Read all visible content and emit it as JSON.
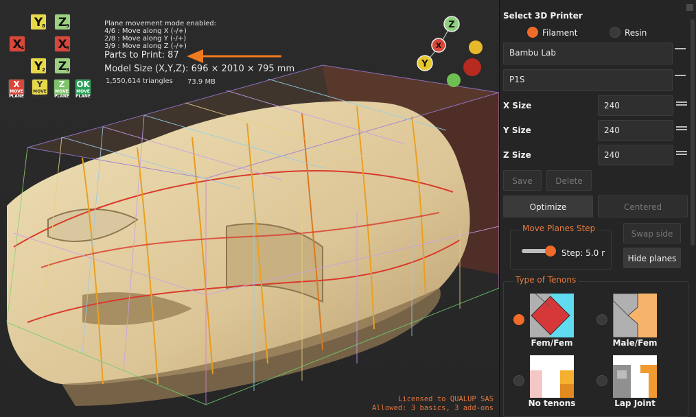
{
  "viewport": {
    "mode_title": "Plane movement mode enabled:",
    "mode_lines": [
      "4/6 : Move along X (-/+)",
      "2/8 : Move along Y (-/+)",
      "3/9 : Move along Z (-/+)"
    ],
    "parts_to_print": "Parts to Print: 87",
    "model_size": "Model Size (X,Y,Z): 696 × 2010 × 795 mm",
    "triangles": "1,550,614 triangles",
    "memory": "73.9 MB",
    "axis_buttons": [
      {
        "axis": "Y",
        "sign": "+",
        "key": "8"
      },
      {
        "axis": "Z",
        "sign": "+",
        "key": "9"
      },
      {
        "axis": "X",
        "sign": "-",
        "key": "4"
      },
      {
        "axis": "X",
        "sign": "+",
        "key": "6"
      },
      {
        "axis": "Y",
        "sign": "-",
        "key": "2"
      },
      {
        "axis": "Z",
        "sign": "-",
        "key": "3"
      }
    ],
    "plane_buttons": [
      {
        "glyph": "X",
        "caption": "MOVE PLANE"
      },
      {
        "glyph": "Y",
        "caption": "MOVE PLANE"
      },
      {
        "glyph": "Z",
        "caption": "MOVE PLANE"
      },
      {
        "glyph": "OK",
        "caption": "MOVE PLANE"
      }
    ],
    "gizmo": {
      "x": "X",
      "y": "Y",
      "z": "Z"
    },
    "license_line1": "Licensed to QUALUP SAS",
    "license_line2": "Allowed: 3 basics, 3 add-ons",
    "colors": {
      "accent": "#f07a1e",
      "model": "#e6d2a4"
    }
  },
  "panel": {
    "title": "Select 3D  Printer",
    "filament_label": "Filament",
    "resin_label": "Resin",
    "brand": "Bambu Lab",
    "model": "P1S",
    "x_label": "X Size",
    "x_value": "240",
    "y_label": "Y Size",
    "y_value": "240",
    "z_label": "Z Size",
    "z_value": "240",
    "save": "Save",
    "delete": "Delete",
    "optimize": "Optimize",
    "centered": "Centered",
    "move_planes_title": "Move Planes Step",
    "step": "Step: 5.0 r",
    "swap_side": "Swap side",
    "hide_planes": "Hide planes",
    "tenons_title": "Type of Tenons",
    "tenons": [
      "Fem/Fem",
      "Male/Fem",
      "No tenons",
      "Lap Joint"
    ],
    "accent": "#f06b2a"
  }
}
